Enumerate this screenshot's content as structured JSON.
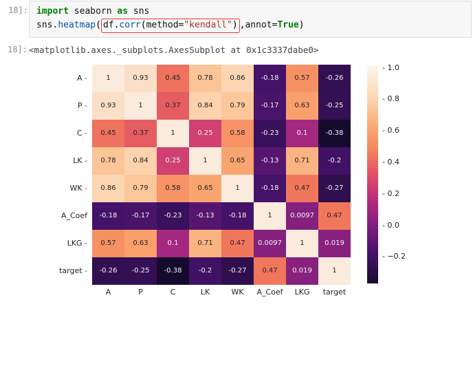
{
  "input_prompt": "18]:",
  "output_prompt": "18]:",
  "code": {
    "kw_import": "import",
    "seaborn": "seaborn",
    "kw_as": "as",
    "sns": "sns",
    "heatmap": "heatmap",
    "df": "df",
    "corr": "corr",
    "method_eq": "method=",
    "kendall": "\"kendall\"",
    "annot_eq": "annot=",
    "true": "True"
  },
  "output_text": "<matplotlib.axes._subplots.AxesSubplot at 0x1c3337dabe0>",
  "chart_data": {
    "type": "heatmap",
    "xlabels": [
      "A",
      "P",
      "C",
      "LK",
      "WK",
      "A_Coef",
      "LKG",
      "target"
    ],
    "ylabels": [
      "A",
      "P",
      "C",
      "LK",
      "WK",
      "A_Coef",
      "LKG",
      "target"
    ],
    "values": [
      [
        1,
        0.93,
        0.45,
        0.78,
        0.86,
        -0.18,
        0.57,
        -0.26
      ],
      [
        0.93,
        1,
        0.37,
        0.84,
        0.79,
        -0.17,
        0.63,
        -0.25
      ],
      [
        0.45,
        0.37,
        1,
        0.25,
        0.58,
        -0.23,
        0.1,
        -0.38
      ],
      [
        0.78,
        0.84,
        0.25,
        1,
        0.65,
        -0.13,
        0.71,
        -0.2
      ],
      [
        0.86,
        0.79,
        0.58,
        0.65,
        1,
        -0.18,
        0.47,
        -0.27
      ],
      [
        -0.18,
        -0.17,
        -0.23,
        -0.13,
        -0.18,
        1,
        0.0097,
        0.47
      ],
      [
        0.57,
        0.63,
        0.1,
        0.71,
        0.47,
        0.0097,
        1,
        0.019
      ],
      [
        -0.26,
        -0.25,
        -0.38,
        -0.2,
        -0.27,
        0.47,
        0.019,
        1
      ]
    ],
    "colorbar_ticks": [
      1.0,
      0.8,
      0.6,
      0.4,
      0.2,
      0.0,
      -0.2
    ],
    "vmin": -0.38,
    "vmax": 1.0
  }
}
